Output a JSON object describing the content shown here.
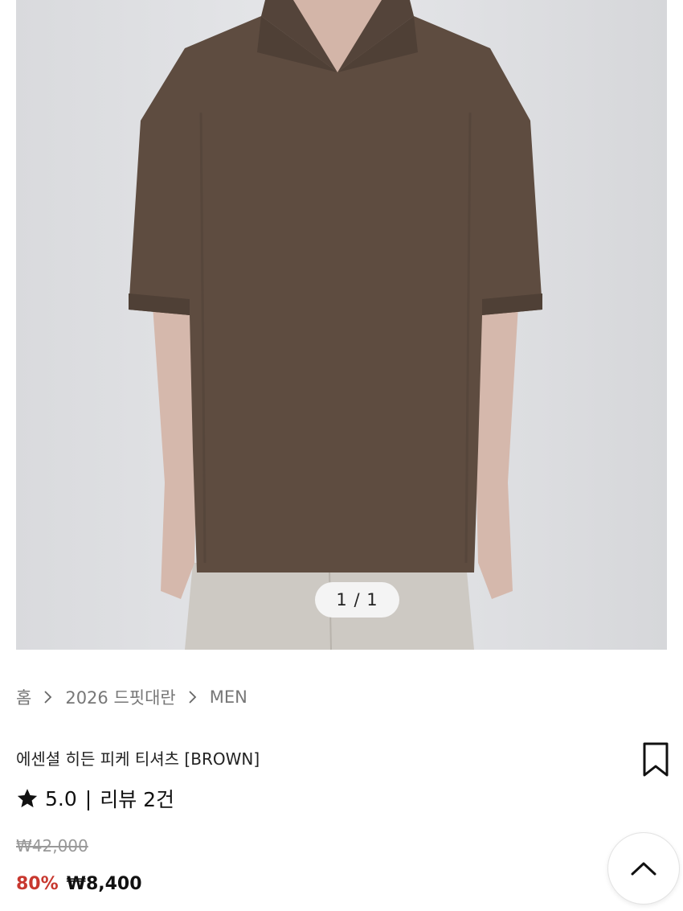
{
  "gallery": {
    "pager": "1 / 1"
  },
  "breadcrumb": {
    "items": [
      "홈",
      "2026 드핏대란",
      "MEN"
    ]
  },
  "product": {
    "title": "에센셜 히든 피케 티셔츠 [BROWN]",
    "rating": "5.0",
    "rating_separator": "|",
    "review_label": "리뷰 2건",
    "original_price": "₩42,000",
    "discount": "80%",
    "sale_price": "₩8,400"
  },
  "icons": {
    "breadcrumb_separator": "chevron-right-icon",
    "bookmark": "bookmark-icon",
    "rating": "star-icon",
    "scroll_top": "chevron-up-icon"
  },
  "colors": {
    "discount": "#c8382f",
    "shirt": "#5e4c40",
    "backdrop": "#e2e3e6"
  }
}
